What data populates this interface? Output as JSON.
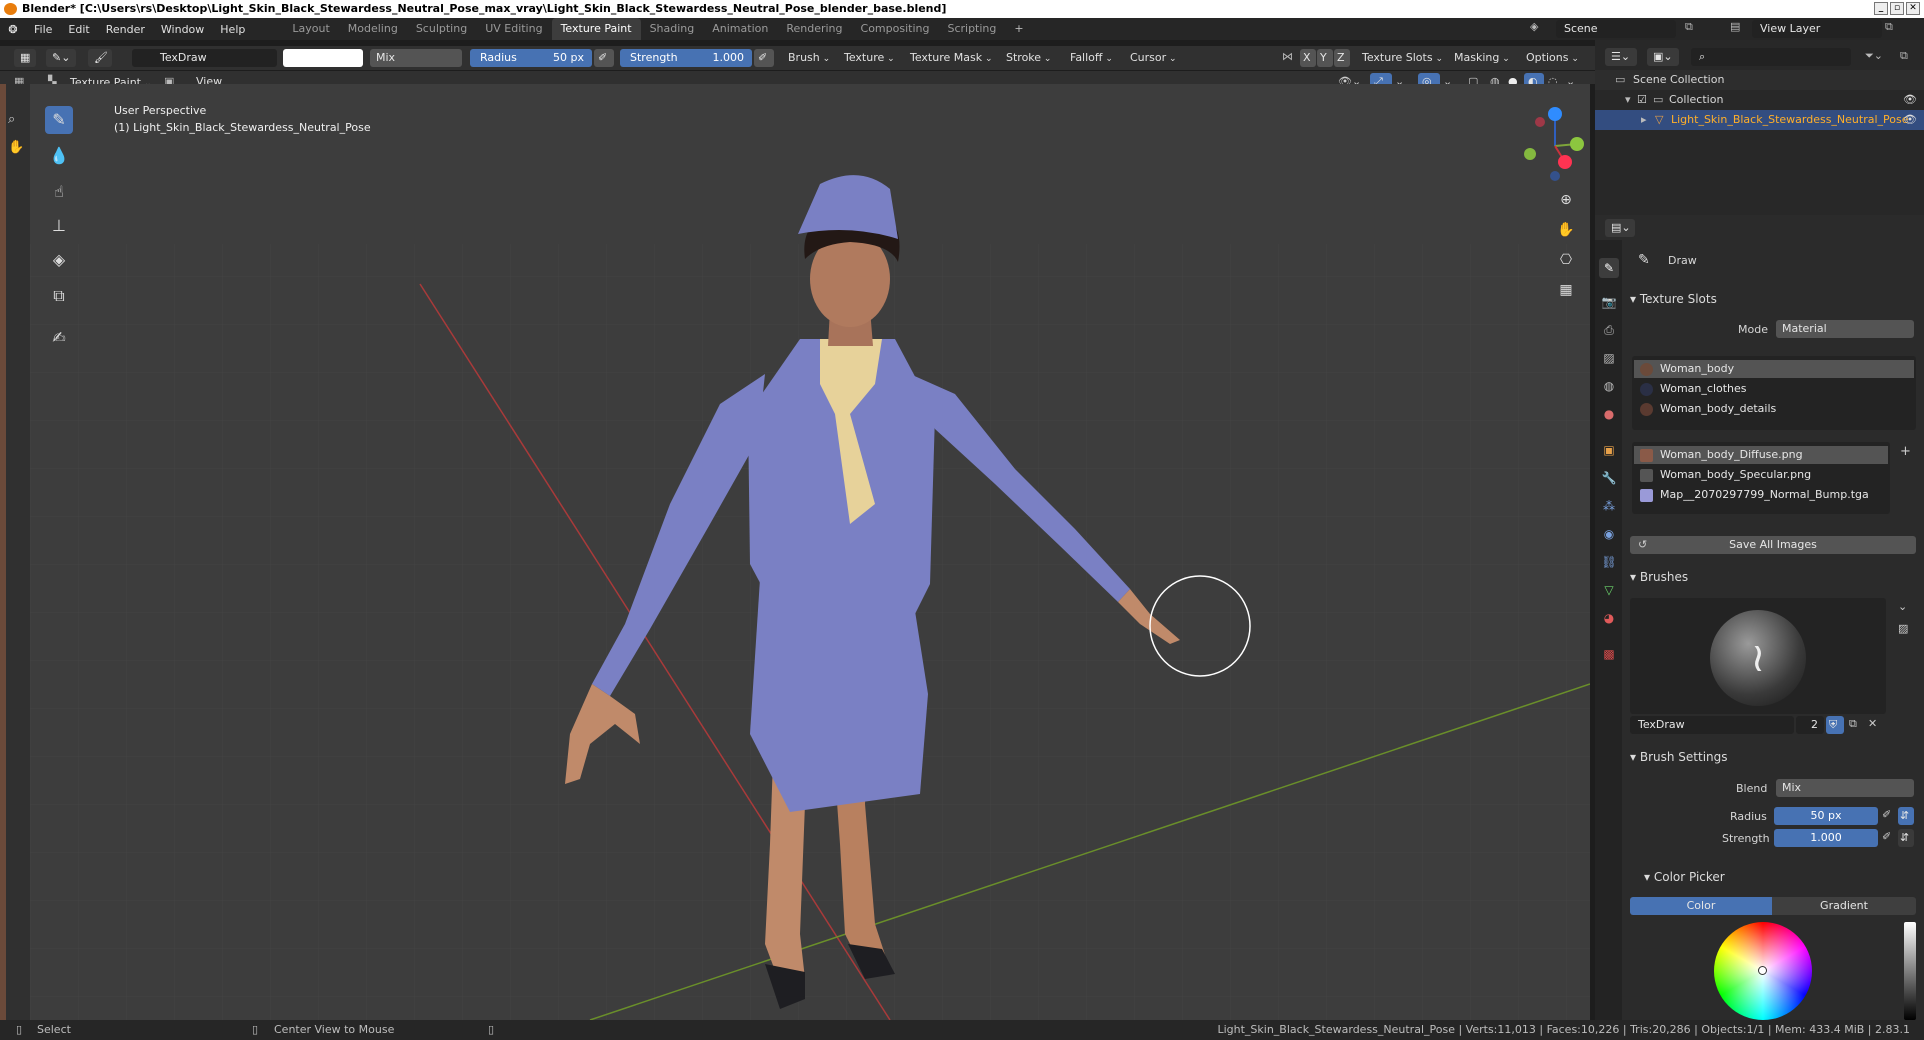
{
  "window": {
    "title": "Blender* [C:\\Users\\rs\\Desktop\\Light_Skin_Black_Stewardess_Neutral_Pose_max_vray\\Light_Skin_Black_Stewardess_Neutral_Pose_blender_base.blend]"
  },
  "menus": [
    "File",
    "Edit",
    "Render",
    "Window",
    "Help"
  ],
  "workspaces": [
    {
      "label": "Layout",
      "active": false
    },
    {
      "label": "Modeling",
      "active": false
    },
    {
      "label": "Sculpting",
      "active": false
    },
    {
      "label": "UV Editing",
      "active": false
    },
    {
      "label": "Texture Paint",
      "active": true
    },
    {
      "label": "Shading",
      "active": false
    },
    {
      "label": "Animation",
      "active": false
    },
    {
      "label": "Rendering",
      "active": false
    },
    {
      "label": "Compositing",
      "active": false
    },
    {
      "label": "Scripting",
      "active": false
    }
  ],
  "scene": {
    "name": "Scene",
    "view_layer": "View Layer"
  },
  "toolheader": {
    "brush_name": "TexDraw",
    "blend": "Mix",
    "radius_label": "Radius",
    "radius_value": "50 px",
    "strength_label": "Strength",
    "strength_value": "1.000",
    "menus": [
      "Brush",
      "Texture",
      "Texture Mask",
      "Stroke",
      "Falloff",
      "Cursor"
    ],
    "axes": [
      "X",
      "Y",
      "Z"
    ],
    "right_menus": [
      "Texture Slots",
      "Masking",
      "Options"
    ]
  },
  "viewheader": {
    "mode": "Texture Paint",
    "view": "View"
  },
  "viewport": {
    "perspective": "User Perspective",
    "object_label": "(1) Light_Skin_Black_Stewardess_Neutral_Pose"
  },
  "outliner": {
    "scene_collection": "Scene Collection",
    "collection": "Collection",
    "object": "Light_Skin_Black_Stewardess_Neutral_Pose"
  },
  "properties": {
    "tool_name": "Draw",
    "texture_slots": {
      "title": "Texture Slots",
      "mode_label": "Mode",
      "mode_value": "Material",
      "materials": [
        "Woman_body",
        "Woman_clothes",
        "Woman_body_details"
      ],
      "images": [
        "Woman_body_Diffuse.png",
        "Woman_body_Specular.png",
        "Map__2070297799_Normal_Bump.tga"
      ],
      "save_all": "Save All Images"
    },
    "brushes": {
      "title": "Brushes",
      "brush_name": "TexDraw",
      "users": "2"
    },
    "brush_settings": {
      "title": "Brush Settings",
      "blend_label": "Blend",
      "blend_value": "Mix",
      "radius_label": "Radius",
      "radius_value": "50 px",
      "strength_label": "Strength",
      "strength_value": "1.000"
    },
    "color_picker": {
      "title": "Color Picker",
      "tabs": [
        "Color",
        "Gradient"
      ]
    }
  },
  "status": {
    "select": "Select",
    "center": "Center View to Mouse",
    "stats": "Light_Skin_Black_Stewardess_Neutral_Pose | Verts:11,013 | Faces:10,226 | Tris:20,286 | Objects:1/1 | Mem: 433.4 MiB | 2.83.1"
  },
  "colors": {
    "accent": "#4772b3",
    "uniform": "#7a80c4",
    "background": "#3d3d3d"
  }
}
